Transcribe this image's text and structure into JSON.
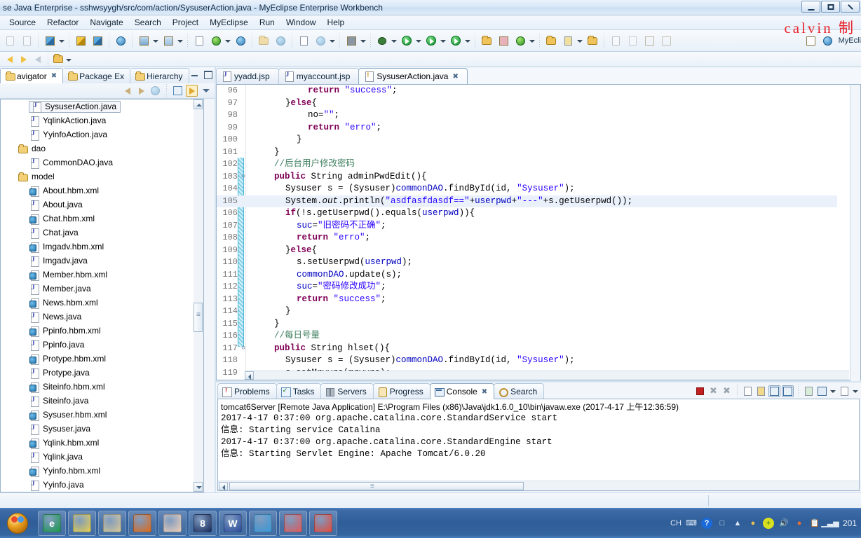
{
  "window": {
    "title": "se Java Enterprise - sshwsyygh/src/com/action/SysuserAction.java - MyEclipse Enterprise Workbench",
    "watermark": "calvin 制"
  },
  "menu": {
    "items": [
      "Source",
      "Refactor",
      "Navigate",
      "Search",
      "Project",
      "MyEclipse",
      "Run",
      "Window",
      "Help"
    ]
  },
  "toolbar": {
    "myeclipse_label": "MyEcli"
  },
  "left_panel": {
    "tabs": [
      {
        "label": "avigator",
        "icon": "navigator-icon",
        "active": true,
        "closable": true
      },
      {
        "label": "Package Ex",
        "icon": "package-explorer-icon",
        "active": false,
        "closable": false
      },
      {
        "label": "Hierarchy",
        "icon": "hierarchy-icon",
        "active": false,
        "closable": false
      }
    ],
    "tree": [
      {
        "label": "SysuserAction.java",
        "icon": "java-file-icon",
        "indent": 1,
        "selected": true
      },
      {
        "label": "YqlinkAction.java",
        "icon": "java-file-icon",
        "indent": 1,
        "selected": false
      },
      {
        "label": "YyinfoAction.java",
        "icon": "java-file-icon",
        "indent": 1,
        "selected": false
      },
      {
        "label": "dao",
        "icon": "package-icon",
        "indent": 0,
        "selected": false
      },
      {
        "label": "CommonDAO.java",
        "icon": "java-file-icon",
        "indent": 1,
        "selected": false
      },
      {
        "label": "model",
        "icon": "package-icon",
        "indent": 0,
        "selected": false
      },
      {
        "label": "About.hbm.xml",
        "icon": "xml-file-icon",
        "indent": 1,
        "selected": false
      },
      {
        "label": "About.java",
        "icon": "java-file-icon",
        "indent": 1,
        "selected": false
      },
      {
        "label": "Chat.hbm.xml",
        "icon": "xml-file-icon",
        "indent": 1,
        "selected": false
      },
      {
        "label": "Chat.java",
        "icon": "java-file-icon",
        "indent": 1,
        "selected": false
      },
      {
        "label": "Imgadv.hbm.xml",
        "icon": "xml-file-icon",
        "indent": 1,
        "selected": false
      },
      {
        "label": "Imgadv.java",
        "icon": "java-file-icon",
        "indent": 1,
        "selected": false
      },
      {
        "label": "Member.hbm.xml",
        "icon": "xml-file-icon",
        "indent": 1,
        "selected": false
      },
      {
        "label": "Member.java",
        "icon": "java-file-icon",
        "indent": 1,
        "selected": false
      },
      {
        "label": "News.hbm.xml",
        "icon": "xml-file-icon",
        "indent": 1,
        "selected": false
      },
      {
        "label": "News.java",
        "icon": "java-file-icon",
        "indent": 1,
        "selected": false
      },
      {
        "label": "Ppinfo.hbm.xml",
        "icon": "xml-file-icon",
        "indent": 1,
        "selected": false
      },
      {
        "label": "Ppinfo.java",
        "icon": "java-file-icon",
        "indent": 1,
        "selected": false
      },
      {
        "label": "Protype.hbm.xml",
        "icon": "xml-file-icon",
        "indent": 1,
        "selected": false
      },
      {
        "label": "Protype.java",
        "icon": "java-file-icon",
        "indent": 1,
        "selected": false
      },
      {
        "label": "Siteinfo.hbm.xml",
        "icon": "xml-file-icon",
        "indent": 1,
        "selected": false
      },
      {
        "label": "Siteinfo.java",
        "icon": "java-file-icon",
        "indent": 1,
        "selected": false
      },
      {
        "label": "Sysuser.hbm.xml",
        "icon": "xml-file-icon",
        "indent": 1,
        "selected": false
      },
      {
        "label": "Sysuser.java",
        "icon": "java-file-icon",
        "indent": 1,
        "selected": false
      },
      {
        "label": "Yqlink.hbm.xml",
        "icon": "xml-file-icon",
        "indent": 1,
        "selected": false
      },
      {
        "label": "Yqlink.java",
        "icon": "java-file-icon",
        "indent": 1,
        "selected": false
      },
      {
        "label": "Yyinfo.hbm.xml",
        "icon": "xml-file-icon",
        "indent": 1,
        "selected": false
      },
      {
        "label": "Yyinfo.java",
        "icon": "java-file-icon",
        "indent": 1,
        "selected": false
      }
    ]
  },
  "editor": {
    "tabs": [
      {
        "label": "yyadd.jsp",
        "icon": "jsp-file-icon",
        "active": false,
        "closable": false
      },
      {
        "label": "myaccount.jsp",
        "icon": "jsp-file-icon",
        "active": false,
        "closable": false
      },
      {
        "label": "SysuserAction.java",
        "icon": "java-file-icon",
        "active": true,
        "closable": true
      }
    ],
    "first_line": 96,
    "highlight_line": 105,
    "lines": [
      {
        "n": 96,
        "fold": "",
        "indent": 5,
        "tokens": [
          {
            "t": "return ",
            "c": "kw"
          },
          {
            "t": "\"success\"",
            "c": "str"
          },
          {
            "t": ";",
            "c": "cn"
          }
        ]
      },
      {
        "n": 97,
        "fold": "",
        "indent": 3,
        "tokens": [
          {
            "t": "}",
            "c": "cn"
          },
          {
            "t": "else",
            "c": "kw"
          },
          {
            "t": "{",
            "c": "cn"
          }
        ]
      },
      {
        "n": 98,
        "fold": "",
        "indent": 5,
        "tokens": [
          {
            "t": "no=",
            "c": "cn"
          },
          {
            "t": "\"\"",
            "c": "str"
          },
          {
            "t": ";",
            "c": "cn"
          }
        ]
      },
      {
        "n": 99,
        "fold": "",
        "indent": 5,
        "tokens": [
          {
            "t": "return ",
            "c": "kw"
          },
          {
            "t": "\"erro\"",
            "c": "str"
          },
          {
            "t": ";",
            "c": "cn"
          }
        ]
      },
      {
        "n": 100,
        "fold": "",
        "indent": 4,
        "tokens": [
          {
            "t": "}",
            "c": "cn"
          }
        ]
      },
      {
        "n": 101,
        "fold": "",
        "indent": 2,
        "tokens": [
          {
            "t": "}",
            "c": "cn"
          }
        ]
      },
      {
        "n": 102,
        "fold": "",
        "indent": 2,
        "tokens": [
          {
            "t": "//后台用户修改密码",
            "c": "cmt"
          }
        ]
      },
      {
        "n": 103,
        "fold": "⊝",
        "indent": 2,
        "tokens": [
          {
            "t": "public ",
            "c": "kw"
          },
          {
            "t": "String adminPwdEdit(){",
            "c": "cn"
          }
        ]
      },
      {
        "n": 104,
        "fold": "",
        "indent": 3,
        "tokens": [
          {
            "t": "Sysuser s = (Sysuser)",
            "c": "cn"
          },
          {
            "t": "commonDAO",
            "c": "fld"
          },
          {
            "t": ".findById(id, ",
            "c": "cn"
          },
          {
            "t": "\"Sysuser\"",
            "c": "str"
          },
          {
            "t": ");",
            "c": "cn"
          }
        ]
      },
      {
        "n": 105,
        "fold": "",
        "indent": 3,
        "tokens": [
          {
            "t": "System.",
            "c": "cn"
          },
          {
            "t": "out",
            "c": "stat"
          },
          {
            "t": ".println(",
            "c": "cn"
          },
          {
            "t": "\"asdfasfdasdf==\"",
            "c": "str"
          },
          {
            "t": "+",
            "c": "cn"
          },
          {
            "t": "userpwd",
            "c": "fld"
          },
          {
            "t": "+",
            "c": "cn"
          },
          {
            "t": "\"---\"",
            "c": "str"
          },
          {
            "t": "+s.getUserpwd());",
            "c": "cn"
          }
        ]
      },
      {
        "n": 106,
        "fold": "",
        "indent": 3,
        "tokens": [
          {
            "t": "if",
            "c": "kw"
          },
          {
            "t": "(!s.getUserpwd().equals(",
            "c": "cn"
          },
          {
            "t": "userpwd",
            "c": "fld"
          },
          {
            "t": ")){",
            "c": "cn"
          }
        ]
      },
      {
        "n": 107,
        "fold": "",
        "indent": 4,
        "tokens": [
          {
            "t": "suc",
            "c": "fld"
          },
          {
            "t": "=",
            "c": "cn"
          },
          {
            "t": "\"旧密码不正确\"",
            "c": "str"
          },
          {
            "t": ";",
            "c": "cn"
          }
        ]
      },
      {
        "n": 108,
        "fold": "",
        "indent": 4,
        "tokens": [
          {
            "t": "return ",
            "c": "kw"
          },
          {
            "t": "\"erro\"",
            "c": "str"
          },
          {
            "t": ";",
            "c": "cn"
          }
        ]
      },
      {
        "n": 109,
        "fold": "",
        "indent": 3,
        "tokens": [
          {
            "t": "}",
            "c": "cn"
          },
          {
            "t": "else",
            "c": "kw"
          },
          {
            "t": "{",
            "c": "cn"
          }
        ]
      },
      {
        "n": 110,
        "fold": "",
        "indent": 4,
        "tokens": [
          {
            "t": "s.setUserpwd(",
            "c": "cn"
          },
          {
            "t": "userpwd",
            "c": "fld"
          },
          {
            "t": ");",
            "c": "cn"
          }
        ]
      },
      {
        "n": 111,
        "fold": "",
        "indent": 4,
        "tokens": [
          {
            "t": "commonDAO",
            "c": "fld"
          },
          {
            "t": ".update(s);",
            "c": "cn"
          }
        ]
      },
      {
        "n": 112,
        "fold": "",
        "indent": 4,
        "tokens": [
          {
            "t": "suc",
            "c": "fld"
          },
          {
            "t": "=",
            "c": "cn"
          },
          {
            "t": "\"密码修改成功\"",
            "c": "str"
          },
          {
            "t": ";",
            "c": "cn"
          }
        ]
      },
      {
        "n": 113,
        "fold": "",
        "indent": 4,
        "tokens": [
          {
            "t": "return ",
            "c": "kw"
          },
          {
            "t": "\"success\"",
            "c": "str"
          },
          {
            "t": ";",
            "c": "cn"
          }
        ]
      },
      {
        "n": 114,
        "fold": "",
        "indent": 3,
        "tokens": [
          {
            "t": "}",
            "c": "cn"
          }
        ]
      },
      {
        "n": 115,
        "fold": "",
        "indent": 2,
        "tokens": [
          {
            "t": "}",
            "c": "cn"
          }
        ]
      },
      {
        "n": 116,
        "fold": "",
        "indent": 2,
        "tokens": [
          {
            "t": "//每日号量",
            "c": "cmt"
          }
        ]
      },
      {
        "n": 117,
        "fold": "⊝",
        "indent": 2,
        "tokens": [
          {
            "t": "public ",
            "c": "kw"
          },
          {
            "t": "String hlset(){",
            "c": "cn"
          }
        ]
      },
      {
        "n": 118,
        "fold": "",
        "indent": 3,
        "tokens": [
          {
            "t": "Sysuser s = (Sysuser)",
            "c": "cn"
          },
          {
            "t": "commonDAO",
            "c": "fld"
          },
          {
            "t": ".findById(id, ",
            "c": "cn"
          },
          {
            "t": "\"Sysuser\"",
            "c": "str"
          },
          {
            "t": ");",
            "c": "cn"
          }
        ]
      },
      {
        "n": 119,
        "fold": "",
        "indent": 3,
        "tokens": [
          {
            "t": "s.setMryyrs(mryyrs);",
            "c": "cn"
          }
        ]
      }
    ]
  },
  "console": {
    "tabs": [
      {
        "label": "Problems",
        "icon": "problems-icon",
        "active": false,
        "closable": false
      },
      {
        "label": "Tasks",
        "icon": "tasks-icon",
        "active": false,
        "closable": false
      },
      {
        "label": "Servers",
        "icon": "servers-icon",
        "active": false,
        "closable": false
      },
      {
        "label": "Progress",
        "icon": "progress-icon",
        "active": false,
        "closable": false
      },
      {
        "label": "Console",
        "icon": "console-icon",
        "active": true,
        "closable": true
      },
      {
        "label": "Search",
        "icon": "search-icon",
        "active": false,
        "closable": false
      }
    ],
    "header": "tomcat6Server [Remote Java Application] E:\\Program Files (x86)\\Java\\jdk1.6.0_10\\bin\\javaw.exe (2017-4-17 上午12:36:59)",
    "output": [
      "2017-4-17 0:37:00 org.apache.catalina.core.StandardService start",
      "信息: Starting service Catalina",
      "2017-4-17 0:37:00 org.apache.catalina.core.StandardEngine start",
      "信息: Starting Servlet Engine: Apache Tomcat/6.0.20"
    ]
  },
  "taskbar": {
    "apps": [
      {
        "name": "internet-explorer-icon",
        "glyph": "e",
        "color": "#1a9a4a"
      },
      {
        "name": "notes-icon",
        "glyph": "",
        "color": "#e8d050"
      },
      {
        "name": "explorer-window-icon",
        "glyph": "",
        "color": "#d8c898"
      },
      {
        "name": "firefox-icon",
        "glyph": "",
        "color": "#e06a18"
      },
      {
        "name": "baby-photo-icon",
        "glyph": "",
        "color": "#f0d0b8"
      },
      {
        "name": "eight-app-icon",
        "glyph": "8",
        "color": "#1a2a5a"
      },
      {
        "name": "word-icon",
        "glyph": "W",
        "color": "#2a4a9a"
      },
      {
        "name": "media-player-icon",
        "glyph": "",
        "color": "#3a9ad8"
      },
      {
        "name": "eraser-tool-icon",
        "glyph": "",
        "color": "#e05a5a"
      },
      {
        "name": "cat-app-icon",
        "glyph": "",
        "color": "#e84a3a"
      }
    ],
    "tray": {
      "ime": "CH",
      "time": "201"
    }
  }
}
